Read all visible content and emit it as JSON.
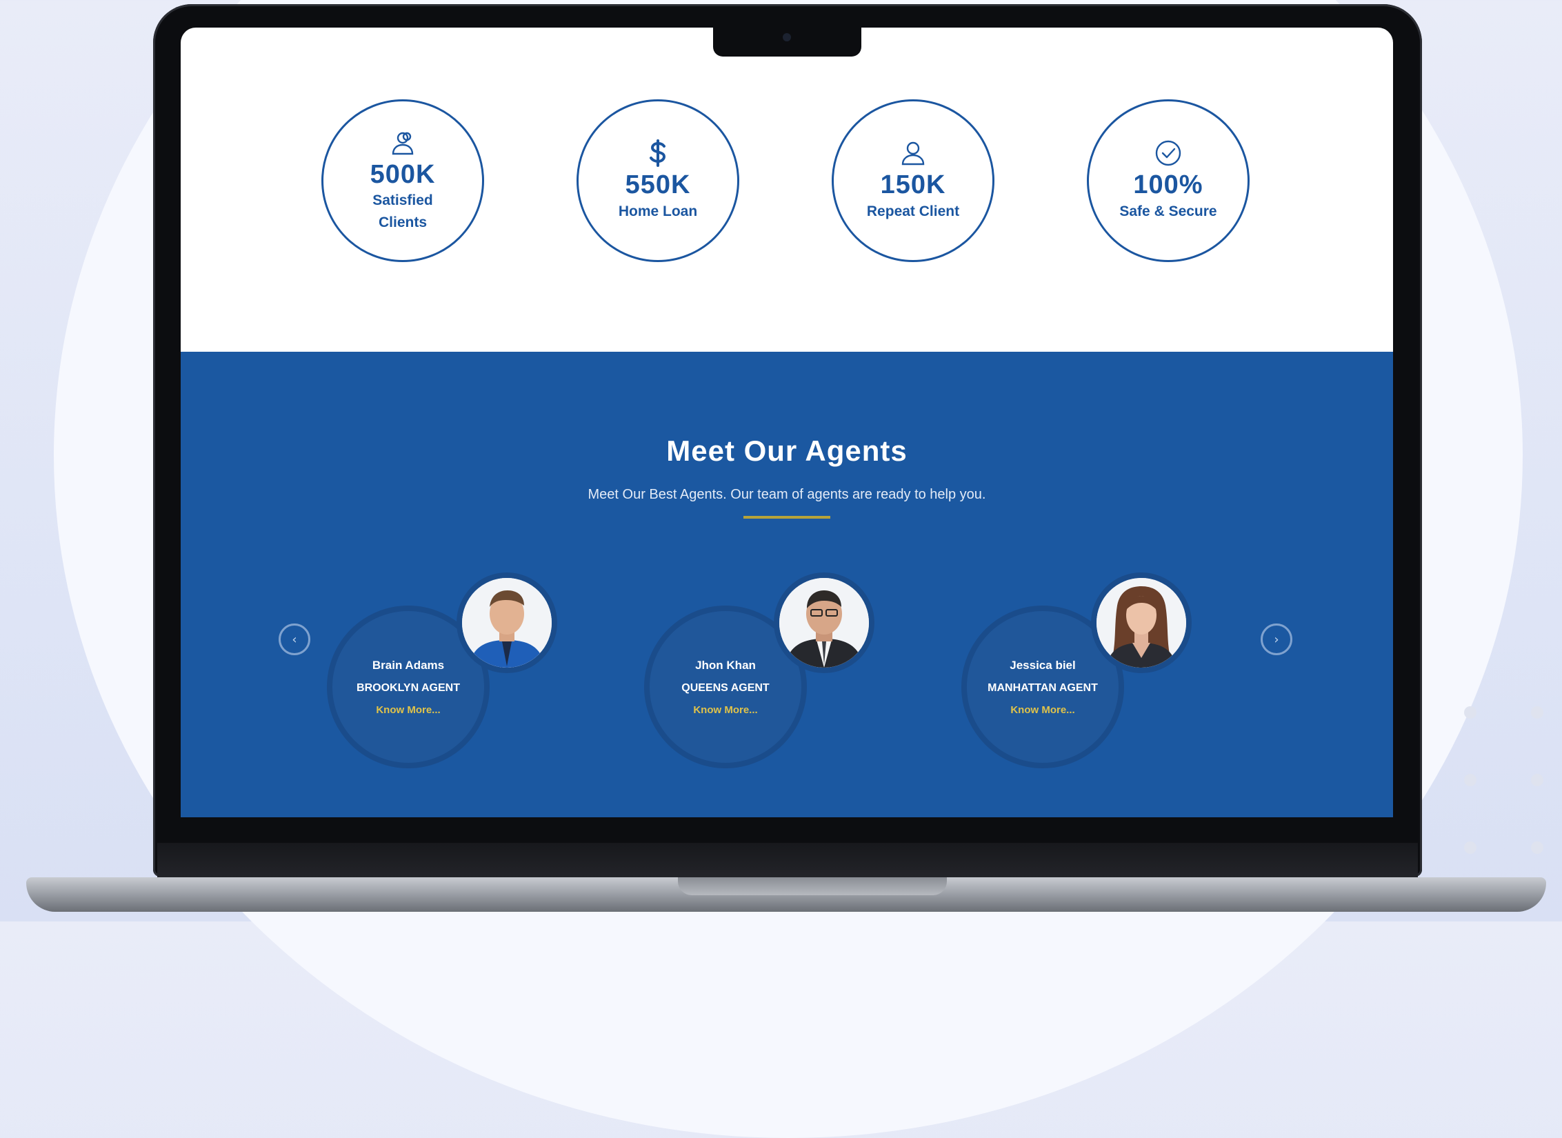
{
  "stats": [
    {
      "icon": "user-group-icon",
      "value": "500K",
      "label": "Satisfied Clients"
    },
    {
      "icon": "dollar-icon",
      "value": "550K",
      "label": "Home Loan"
    },
    {
      "icon": "user-icon",
      "value": "150K",
      "label": "Repeat Client"
    },
    {
      "icon": "check-circle-icon",
      "value": "100%",
      "label": "Safe & Secure"
    }
  ],
  "agents_section": {
    "title": "Meet Our Agents",
    "subtitle": "Meet Our Best Agents. Our team of agents are ready to help you.",
    "prev_icon": "chevron-left-icon",
    "next_icon": "chevron-right-icon",
    "agents": [
      {
        "name": "Brain Adams",
        "role": "BROOKLYN AGENT",
        "link": "Know More..."
      },
      {
        "name": "Jhon Khan",
        "role": "QUEENS AGENT",
        "link": "Know More..."
      },
      {
        "name": "Jessica biel",
        "role": "MANHATTAN AGENT",
        "link": "Know More..."
      }
    ]
  },
  "colors": {
    "brand_blue": "#1b58a1",
    "accent_gold": "#e0c34a",
    "underline": "#b6a33a"
  }
}
